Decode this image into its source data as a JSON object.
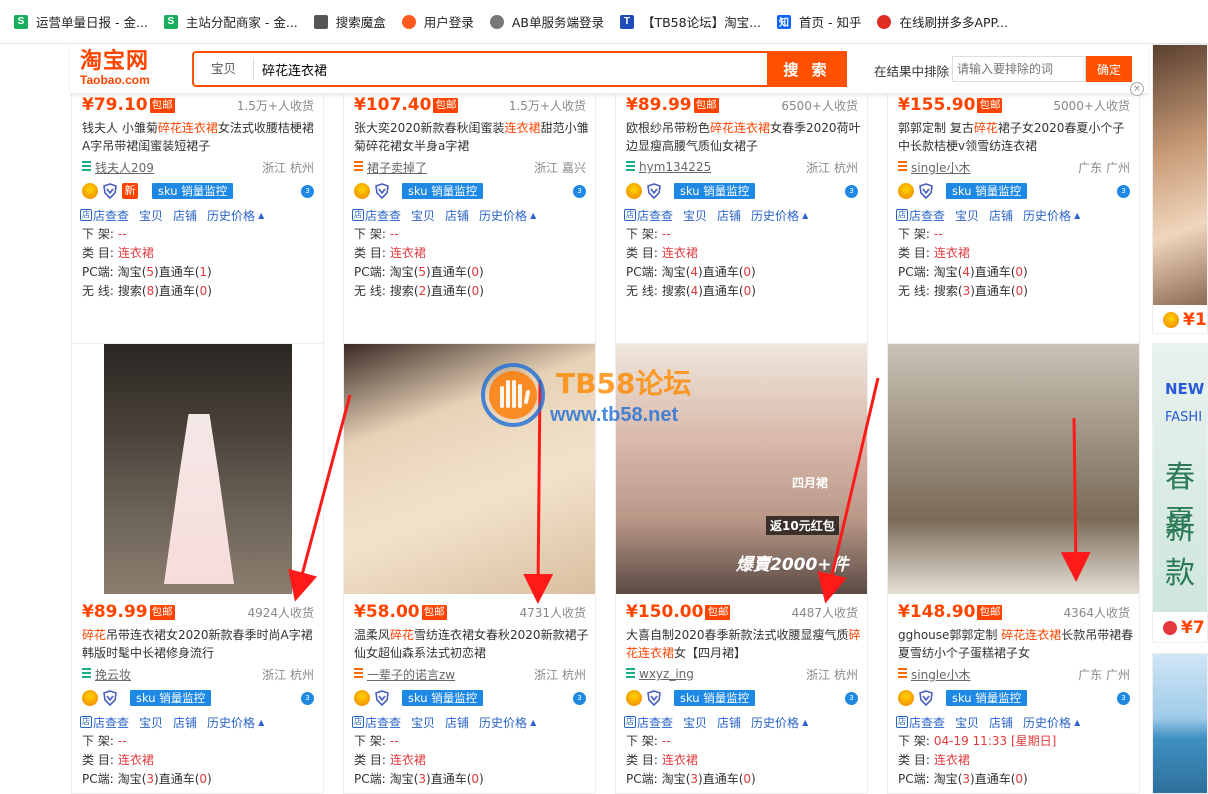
{
  "bookmarks": [
    {
      "label": "运营单量日报 - 金...",
      "icon": "sheet-icon",
      "color": "#1aad5f",
      "glyph": "S"
    },
    {
      "label": "主站分配商家 - 金...",
      "icon": "sheet-icon",
      "color": "#1aad5f",
      "glyph": "S"
    },
    {
      "label": "搜索魔盒",
      "icon": "puzzle-icon",
      "color": "#555555",
      "glyph": ""
    },
    {
      "label": "用户登录",
      "icon": "fire-icon",
      "color": "#ff5a1f",
      "glyph": ""
    },
    {
      "label": "AB单服务端登录",
      "icon": "globe-icon",
      "color": "#777777",
      "glyph": ""
    },
    {
      "label": "【TB58论坛】淘宝...",
      "icon": "t-logo-icon",
      "color": "#1e4bb8",
      "glyph": "T"
    },
    {
      "label": "首页 - 知乎",
      "icon": "zhihu-icon",
      "color": "#0a66ff",
      "glyph": "知"
    },
    {
      "label": "在线刷拼多多APP...",
      "icon": "pdd-icon",
      "color": "#e02e24",
      "glyph": ""
    }
  ],
  "header": {
    "logo_cn": "淘宝网",
    "logo_en": "Taobao.com",
    "search_category": "宝贝",
    "search_value": "碎花连衣裙",
    "search_button": "搜 索",
    "exclude_label": "在结果中排除",
    "exclude_placeholder": "请输入要排除的词",
    "exclude_button": "确定",
    "close_glyph": "×"
  },
  "common": {
    "currency": "¥",
    "baoyou": "包邮",
    "new_badge": "新",
    "sku_label": "sku 销量监控",
    "link_dian": "店",
    "link_check": "店查查",
    "link_item": "宝贝",
    "link_shop": "店铺",
    "link_history": "历史价格",
    "tri": "▲",
    "lbl_offshelf": "下 架:",
    "lbl_category": "类 目:",
    "lbl_pc": "PC端:",
    "lbl_wireless": "无 线:",
    "taobao": "淘宝",
    "ztc": "直通车",
    "search": "搜索",
    "lp": "(",
    "rp": ")"
  },
  "row1": [
    {
      "price": "79.10",
      "sales": "1.5万+人收货",
      "title_a": "钱夫人 小雏菊",
      "title_hl": "碎花连衣裙",
      "title_b": "女法式收腰桔梗裙A字吊带裙闺蜜装短裙子",
      "shop": "钱夫人209",
      "location": "浙江 杭州",
      "new": true,
      "offshelf": "--",
      "category": "连衣裙",
      "pc_taobao": "5",
      "pc_ztc": "1",
      "wl_search": "8",
      "wl_ztc": "0"
    },
    {
      "price": "107.40",
      "sales": "1.5万+人收货",
      "title_a": "张大奕2020新款春秋闺蜜装",
      "title_hl": "连衣裙",
      "title_b": "甜范小雏菊碎花裙女半身a字裙",
      "shop": "裙子卖掉了",
      "location": "浙江 嘉兴",
      "new": false,
      "offshelf": "--",
      "category": "连衣裙",
      "pc_taobao": "5",
      "pc_ztc": "0",
      "wl_search": "2",
      "wl_ztc": "0"
    },
    {
      "price": "89.99",
      "sales": "6500+人收货",
      "title_a": "欧根纱吊带粉色",
      "title_hl": "碎花连衣裙",
      "title_b": "女春季2020荷叶边显瘦高腰气质仙女裙子",
      "shop": "hym134225",
      "location": "浙江 杭州",
      "new": false,
      "offshelf": "--",
      "category": "连衣裙",
      "pc_taobao": "4",
      "pc_ztc": "0",
      "wl_search": "4",
      "wl_ztc": "0"
    },
    {
      "price": "155.90",
      "sales": "5000+人收货",
      "title_a": "郭郭定制 复古",
      "title_hl": "碎花",
      "title_b": "裙子女2020春夏小个子中长款桔梗v领雪纺连衣裙",
      "shop": "single小木",
      "location": "广东 广州",
      "new": false,
      "offshelf": "--",
      "category": "连衣裙",
      "pc_taobao": "4",
      "pc_ztc": "0",
      "wl_search": "3",
      "wl_ztc": "0"
    }
  ],
  "row2": [
    {
      "price": "89.99",
      "sales": "4924人收货",
      "title_a": "",
      "title_hl": "碎花",
      "title_b": "吊带连衣裙女2020新款春季时尚A字裙韩版时髦中长裙修身流行",
      "shop": "挽云妆",
      "location": "浙江 杭州",
      "offshelf": "--",
      "category": "连衣裙",
      "pc_taobao": "3",
      "pc_ztc": "0"
    },
    {
      "price": "58.00",
      "sales": "4731人收货",
      "title_a": "温柔风",
      "title_hl": "碎花",
      "title_b": "雪纺连衣裙女春秋2020新款裙子仙女超仙森系法式初恋裙",
      "shop": "一辈子的诺言zw",
      "location": "浙江 杭州",
      "offshelf": "--",
      "category": "连衣裙",
      "pc_taobao": "3",
      "pc_ztc": "0"
    },
    {
      "price": "150.00",
      "sales": "4487人收货",
      "title_a": "大喜自制2020春季新款法式收腰显瘦气质",
      "title_hl": "碎花连衣裙",
      "title_b": "女【四月裙】",
      "shop": "wxyz_ing",
      "location": "浙江 杭州",
      "offshelf": "--",
      "category": "连衣裙",
      "pc_taobao": "3",
      "pc_ztc": "0"
    },
    {
      "price": "148.90",
      "sales": "4364人收货",
      "title_a": "gghouse郭郭定制 ",
      "title_hl": "碎花连衣裙",
      "title_b": "长款吊带裙春夏雪纺小个子蛋糕裙子女",
      "shop": "single小木",
      "location": "广东 广州",
      "offshelf": "04-19 11:33 [星期日]",
      "category": "连衣裙",
      "pc_taobao": "3",
      "pc_ztc": "0"
    }
  ],
  "image_text": {
    "april": "四月裙",
    "promo": "返10元红包",
    "explode": "爆賣2000+件",
    "side_new": "NEW",
    "side_fashion": "FASHI",
    "side_spring": "春夏",
    "side_xin": "新款"
  },
  "side_prices": [
    "1",
    "7"
  ],
  "watermark": {
    "title": "TB58论坛",
    "url": "www.tb58.net"
  },
  "colors": {
    "accent": "#ff5000",
    "price": "#ff4400",
    "link": "#2a63c7",
    "sku": "#1e88e5"
  }
}
